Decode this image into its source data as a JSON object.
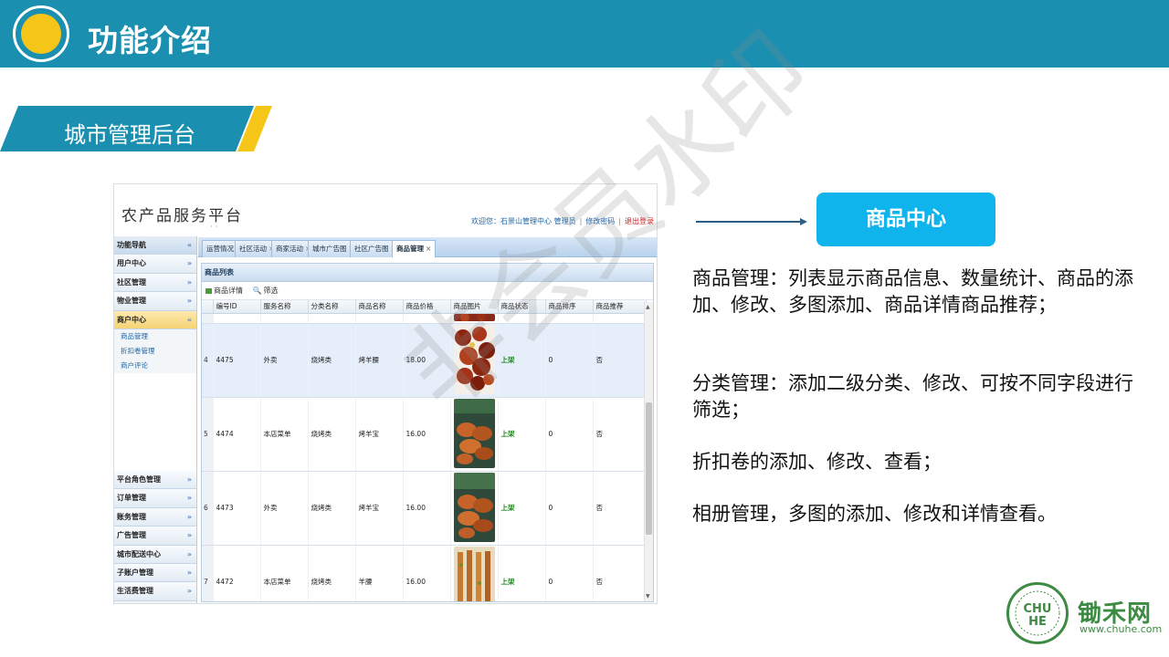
{
  "slide": {
    "title": "功能介绍",
    "section": "城市管理后台"
  },
  "app": {
    "title": "农产品服务平台",
    "title_dots": "· ·",
    "welcome": "欢迎您：石景山管理中心 管理员",
    "change_password": "修改密码",
    "logout": "退出登录",
    "sidebar": {
      "header": "功能导航",
      "items_top": [
        "用户中心",
        "社区管理",
        "物业管理"
      ],
      "active": "商户中心",
      "sub_items": [
        "商品管理",
        "折扣卷管理",
        "商户评论"
      ],
      "items_bottom": [
        "平台角色管理",
        "订单管理",
        "账务管理",
        "广告管理",
        "城市配送中心",
        "子账户管理",
        "生活费管理"
      ]
    },
    "tabs": [
      "运营情况",
      "社区活动",
      "商家活动",
      "城市广告图",
      "社区广告图",
      "商品管理"
    ],
    "list_title": "商品列表",
    "toolbar": {
      "detail": "商品详情",
      "filter": "筛选"
    },
    "columns": [
      "编号ID",
      "服务名称",
      "分类名称",
      "商品名称",
      "商品价格",
      "商品图片",
      "商品状态",
      "商品排序",
      "商品推荐"
    ],
    "rows": [
      {
        "index": "4",
        "id": "4475",
        "service": "外卖",
        "category": "烧烤类",
        "name": "烤羊腰",
        "price": "18.00",
        "status": "上架",
        "sort": "0",
        "recommend": "否"
      },
      {
        "index": "5",
        "id": "4474",
        "service": "本店菜单",
        "category": "烧烤类",
        "name": "烤羊宝",
        "price": "16.00",
        "status": "上架",
        "sort": "0",
        "recommend": "否"
      },
      {
        "index": "6",
        "id": "4473",
        "service": "外卖",
        "category": "烧烤类",
        "name": "烤羊宝",
        "price": "16.00",
        "status": "上架",
        "sort": "0",
        "recommend": "否"
      },
      {
        "index": "7",
        "id": "4472",
        "service": "本店菜单",
        "category": "烧烤类",
        "name": "羊腰",
        "price": "16.00",
        "status": "上架",
        "sort": "0",
        "recommend": "否"
      }
    ],
    "watermark": "非会员水印"
  },
  "callout": "商品中心",
  "descriptions": [
    "商品管理：列表显示商品信息、数量统计、商品的添加、修改、多图添加、商品详情商品推荐；",
    "分类管理：添加二级分类、修改、可按不同字段进行筛选；",
    "折扣卷的添加、修改、查看；",
    "相册管理，多图的添加、修改和详情查看。"
  ],
  "brand": {
    "logo_text": "CHUHE",
    "name": "锄禾网",
    "url": "www.chuhe.com"
  },
  "colors": {
    "banner": "#1b8fb0",
    "accent_yellow": "#f5c518",
    "callout": "#0fb4ec",
    "brand_green": "#3d8a42",
    "status_green": "#1f8a1f"
  }
}
